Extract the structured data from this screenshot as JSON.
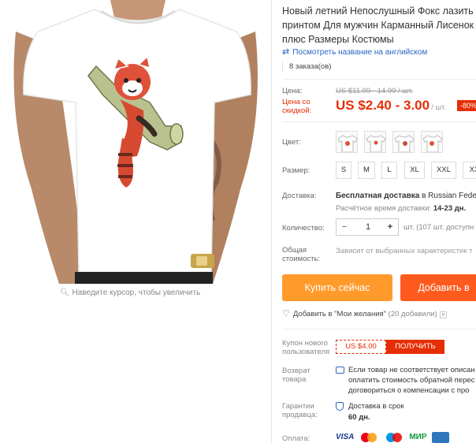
{
  "gallery": {
    "zoom_hint": "Наведите курсор, чтобы увеличить",
    "magnifier_icon": "magnifier-icon"
  },
  "product": {
    "title_line1": "Новый летний Непослушный Фокс лазить п",
    "title_line2": "принтом Для мужчин Карманный Лисенок д",
    "title_line3": "плюс Размеры Костюмы",
    "translate_link": "Посмотреть название на английском",
    "translate_icon": "translate-icon",
    "orders": "8 заказа(ов)"
  },
  "price": {
    "label": "Цена:",
    "old": "US $11.99 - 14.99 / шт.",
    "discount_label_line1": "Цена со",
    "discount_label_line2": "скидкой:",
    "new": "US $2.40 - 3.00",
    "unit": "/ шт.",
    "badge": "-80%",
    "accent_color": "#e62e04"
  },
  "color": {
    "label": "Цвет:",
    "swatches": [
      "variant-1",
      "variant-2",
      "variant-3",
      "variant-4"
    ]
  },
  "size": {
    "label": "Размер:",
    "options": [
      "S",
      "M",
      "L",
      "XL",
      "XXL",
      "XX"
    ]
  },
  "shipping": {
    "label": "Доставка:",
    "value_bold": "Бесплатная доставка",
    "value_rest": " в Russian Feder",
    "time_label": "Расчётное время доставки: ",
    "time_value": "14-23 дн."
  },
  "quantity": {
    "label": "Количество:",
    "minus": "−",
    "value": "1",
    "plus": "+",
    "stock": "шт. (107 шт. доступн"
  },
  "total": {
    "label_line1": "Общая",
    "label_line2": "стоимость:",
    "value": "Зависит от выбранных характеристик т"
  },
  "actions": {
    "buy": "Купить сейчас",
    "cart": "Добавить в",
    "buy_color": "#ff9a2b",
    "cart_color": "#ff5a1d"
  },
  "wishlist": {
    "icon": "heart-icon",
    "text": "Добавить в \"Мои желания\"",
    "count": "(20 добавили)",
    "chevron": "v"
  },
  "coupon": {
    "label_line1": "Купон нового",
    "label_line2": "пользователя",
    "value": "US $4.00",
    "button": "ПОЛУЧИТЬ"
  },
  "returns": {
    "label_line1": "Возврат",
    "label_line2": "товара",
    "line1": "Если товар не соответствует описан",
    "line2": "оплатить стоимость обратной перес",
    "line3": "договориться о компенсации с про"
  },
  "guarantee": {
    "label_line1": "Гарантии",
    "label_line2": "продавца:",
    "line1": "Доставка в срок",
    "line2": "60 дн."
  },
  "payment": {
    "label": "Оплата:",
    "logos": [
      "VISA",
      "MasterCard",
      "Maestro",
      "МИР",
      "AmEx"
    ]
  }
}
